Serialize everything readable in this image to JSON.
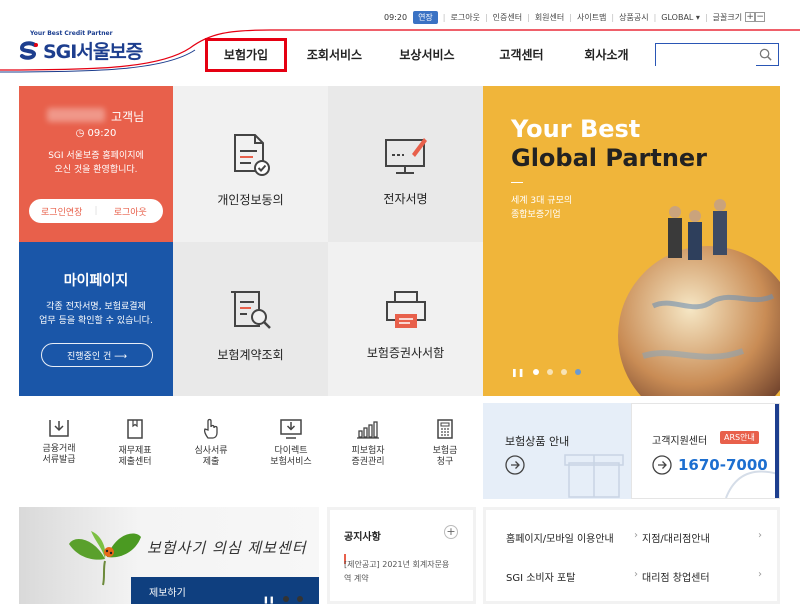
{
  "util": {
    "time": "09:20",
    "extend": "연장",
    "links": [
      "로그아웃",
      "인증센터",
      "회원센터",
      "사이트맵",
      "상품공시",
      "GLOBAL ▾"
    ],
    "font_size_label": "글꼴크기"
  },
  "logo": {
    "tagline": "Your Best Credit Partner",
    "name": "SGI서울보증"
  },
  "nav": [
    "보험가입",
    "조회서비스",
    "보상서비스",
    "고객센터",
    "회사소개"
  ],
  "login": {
    "customer_suffix": "고객님",
    "time": "09:20",
    "welcome": "SGI 서울보증 홈페이지에\n오신 것을 환영합니다.",
    "extend_btn": "로그인연장",
    "logout_btn": "로그아웃"
  },
  "mypage": {
    "title": "마이페이지",
    "desc": "각종 전자서명, 보험료결제\n업무 등을 확인할 수 있습니다.",
    "btn": "진행중인 건  ⟶"
  },
  "tiles": {
    "consent": "개인정보동의",
    "esign": "전자서명",
    "contract": "보험계약조회",
    "certificate": "보험증권사서함"
  },
  "hero": {
    "line1": "Your Best",
    "line2": "Global Partner",
    "sub": "세계 3대 규모의\n종합보증기업"
  },
  "quick": [
    {
      "label": "금융거래\n서류발급"
    },
    {
      "label": "재무제표\n제출센터"
    },
    {
      "label": "심사서류\n제출"
    },
    {
      "label": "다이렉트\n보험서비스"
    },
    {
      "label": "피보험자\n증권관리"
    },
    {
      "label": "보험금\n청구"
    }
  ],
  "product": {
    "title": "보험상품 안내"
  },
  "support": {
    "title": "고객지원센터",
    "badge": "ARS안내",
    "phone": "1670-7000"
  },
  "report": {
    "title": "보험사기 의심 제보센터",
    "btn": "제보하기"
  },
  "notice": {
    "title": "공지사항",
    "item": "[제안공고] 2021년 회계자문용\n역 계약"
  },
  "links": [
    "홈페이지/모바일 이용안내",
    "지점/대리점안내",
    "SGI 소비자 포탈",
    "대리점 창업센터"
  ],
  "colors": {
    "red": "#e8604b",
    "blue": "#1a56a8",
    "accent": "#e50012",
    "hero": "#f0b53a"
  }
}
